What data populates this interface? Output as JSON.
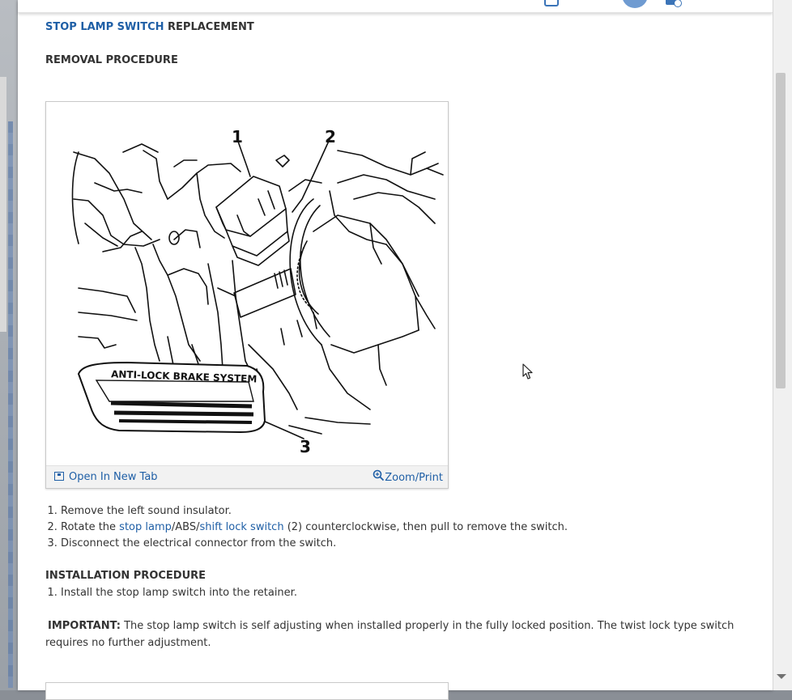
{
  "header": {
    "title_link": "STOP LAMP SWITCH",
    "title_rest": "REPLACEMENT",
    "subtitle": "REMOVAL PROCEDURE"
  },
  "figure": {
    "callouts": [
      "1",
      "2",
      "3"
    ],
    "plate_text": "ANTI-LOCK BRAKE SYSTEM",
    "open_label": "Open In New Tab",
    "zoom_label": "Zoom/Print"
  },
  "removal_steps": {
    "s1": "Remove the left sound insulator.",
    "s2_pre": "Rotate the ",
    "s2_link1": "stop lamp",
    "s2_mid": "/ABS/",
    "s2_link2": "shift lock switch",
    "s2_post": " (2) counterclockwise, then pull to remove the switch.",
    "s3": "Disconnect the electrical connector from the switch."
  },
  "install": {
    "heading": "INSTALLATION PROCEDURE",
    "s1": "Install the stop lamp switch into the retainer.",
    "important_label": "IMPORTANT:",
    "important_text": " The stop lamp switch is self adjusting when installed properly in the fully locked position. The twist lock type switch requires no further adjustment."
  },
  "colors": {
    "link": "#1f5fa6",
    "text": "#333333"
  },
  "icons": [
    "open-tab-icon",
    "zoom-icon",
    "mouse-cursor-icon"
  ]
}
